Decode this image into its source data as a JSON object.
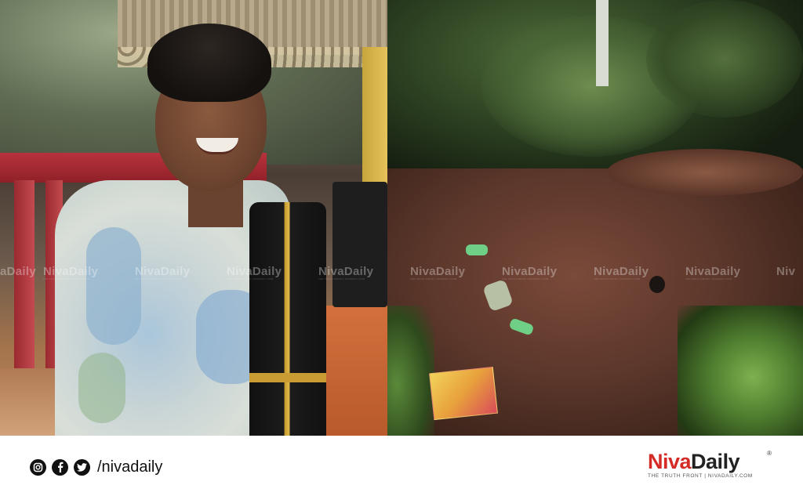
{
  "watermark": {
    "brand": "NivaDaily",
    "tagline": "THE TRUTH FRONT | NIVADAILY.COM",
    "left_edge_fragment": "aDaily",
    "right_edge_fragment": "Niv"
  },
  "footer": {
    "icons": [
      "instagram-icon",
      "facebook-icon",
      "twitter-icon"
    ],
    "handle": "/nivadaily",
    "logo": {
      "niva": "Niva",
      "daily": "Daily",
      "registered": "®",
      "tagline": "THE TRUTH FRONT | NIVADAILY.COM"
    }
  },
  "colors": {
    "brand_red": "#d42b27",
    "text_dark": "#222222",
    "background": "#ffffff"
  }
}
